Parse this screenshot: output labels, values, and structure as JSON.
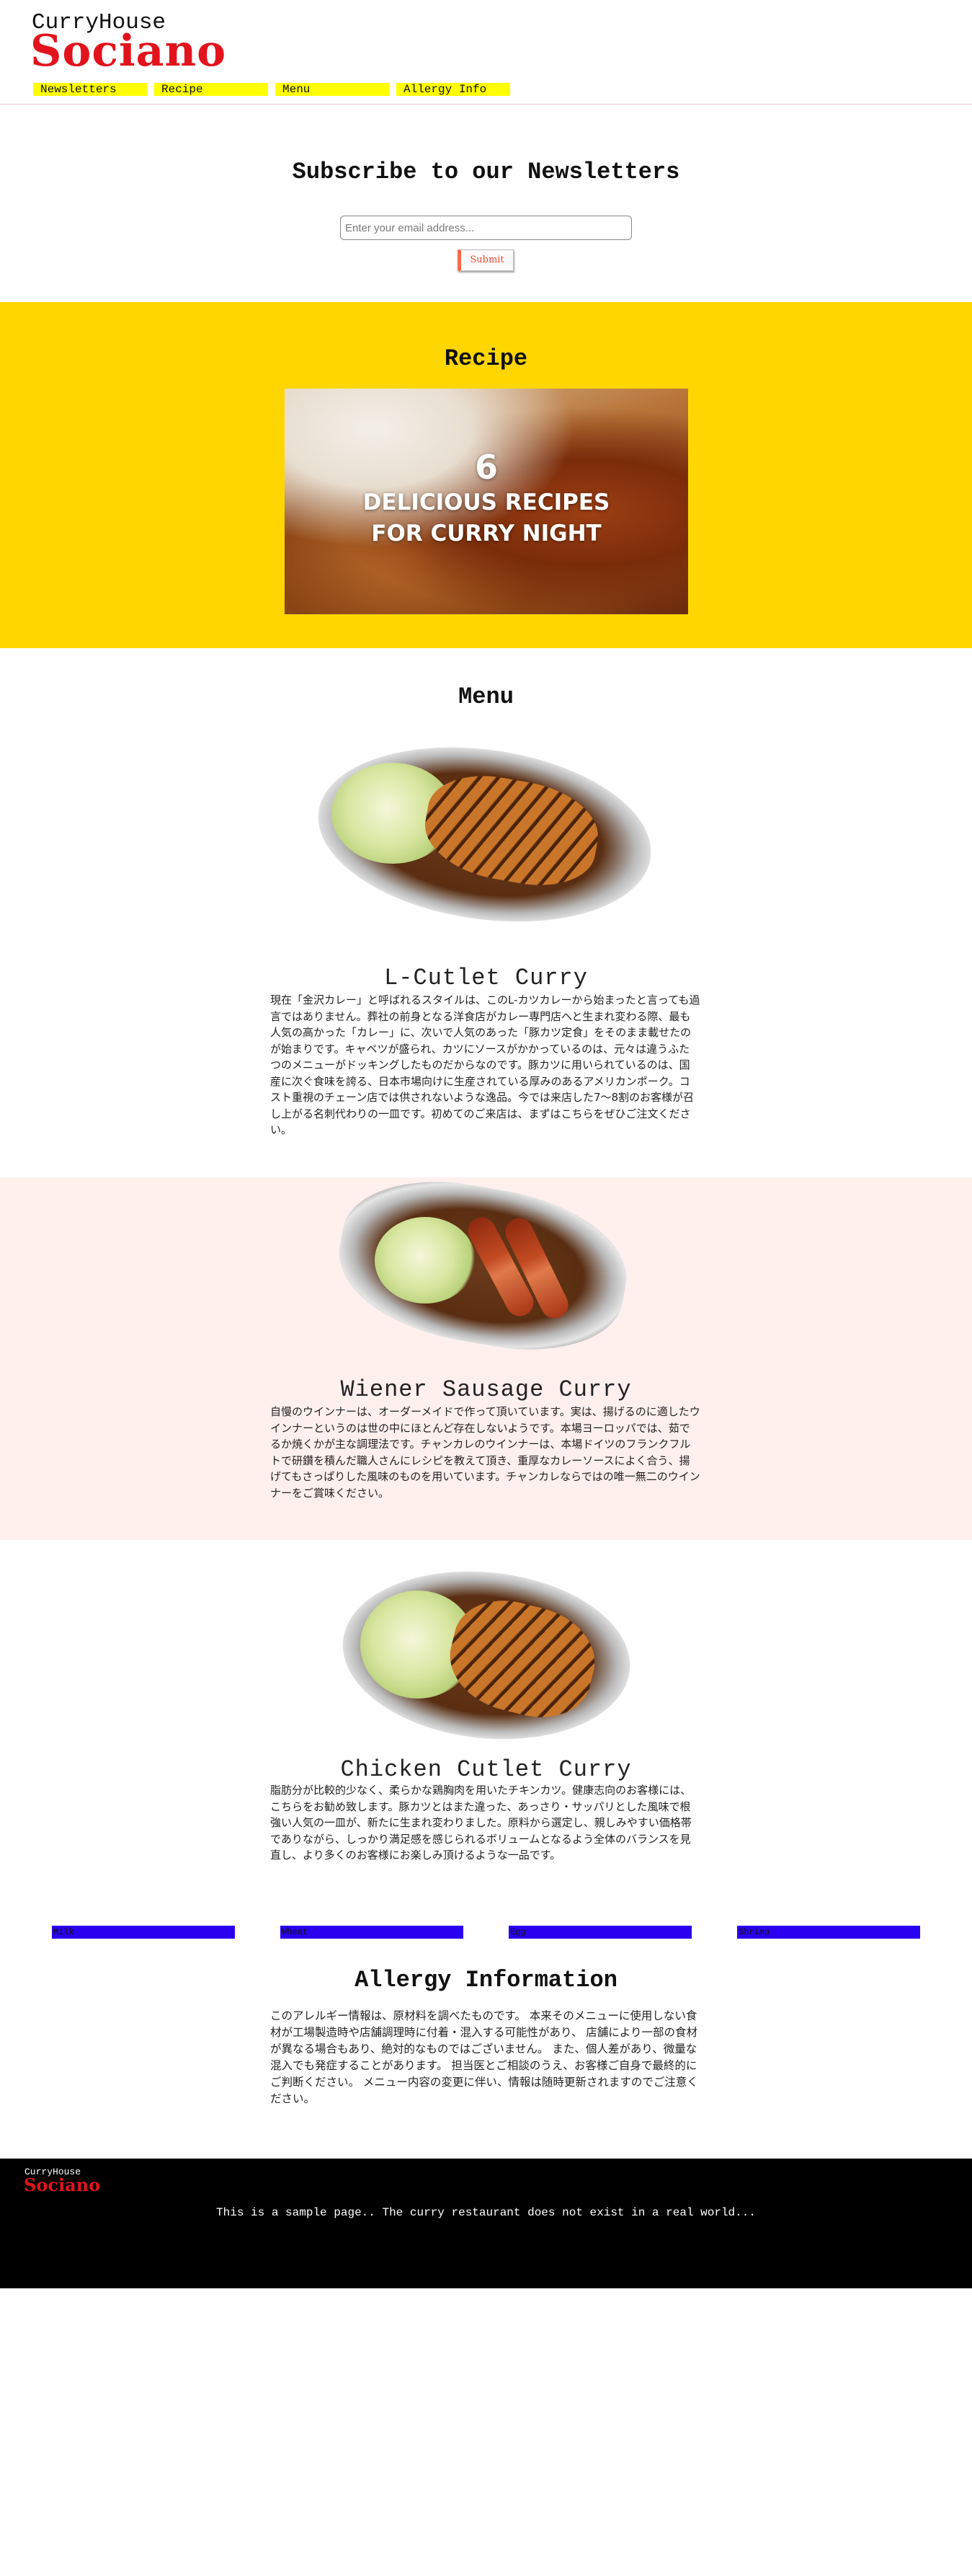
{
  "header": {
    "brand_small": "CurryHouse",
    "brand_big": "Sociano",
    "nav": [
      "Newsletters",
      "Recipe",
      "Menu",
      "Allergy Info"
    ]
  },
  "subscribe": {
    "title": "Subscribe to our Newsletters",
    "email_placeholder": "Enter your email address...",
    "submit_label": "Submit"
  },
  "recipe": {
    "title": "Recipe",
    "image_text": {
      "number": "6",
      "line1": "DELICIOUS RECIPES",
      "line2": "FOR CURRY NIGHT"
    }
  },
  "menu": {
    "title": "Menu",
    "items": [
      {
        "name": "L-Cutlet Curry",
        "description": "現在「金沢カレー」と呼ばれるスタイルは、このL-カツカレーから始まったと言っても過言ではありません。葬社の前身となる洋食店がカレー専門店へと生まれ変わる際、最も人気の高かった「カレー」に、次いで人気のあった「豚カツ定食」をそのまま載せたのが始まりです。キャベツが盛られ、カツにソースがかかっているのは、元々は違うふたつのメニューがドッキングしたものだからなのです。豚カツに用いられているのは、国産に次ぐ食味を誇る、日本市場向けに生産されている厚みのあるアメリカンポーク。コスト重視のチェーン店では供されないような逸品。今では来店した7〜8割のお客様が召し上がる名刺代わりの一皿です。初めてのご来店は、まずはこちらをぜひご注文ください。"
      },
      {
        "name": "Wiener Sausage Curry",
        "description": "自慢のウインナーは、オーダーメイドで作って頂いています。実は、揚げるのに適したウインナーというのは世の中にほとんど存在しないようです。本場ヨーロッパでは、茹でるか焼くかが主な調理法です。チャンカレのウインナーは、本場ドイツのフランクフルトで研鑽を積んだ職人さんにレシピを教えて頂き、重厚なカレーソースによく合う、揚げてもさっぱりした風味のものを用いています。チャンカレならではの唯一無二のウインナーをご賞味ください。"
      },
      {
        "name": "Chicken Cutlet Curry",
        "description": "脂肪分が比較的少なく、柔らかな鶏胸肉を用いたチキンカツ。健康志向のお客様には、こちらをお勧め致します。豚カツとはまた違った、あっさり・サッパリとした風味で根強い人気の一皿が、新たに生まれ変わりました。原料から選定し、親しみやすい価格帯でありながら、しっかり満足感を感じられるボリュームとなるよう全体のバランスを見直し、より多くのお客様にお楽しみ頂けるような一品です。"
      }
    ]
  },
  "allergy": {
    "tabs": [
      "Milk",
      "Wheat",
      "Egg",
      "Shrimp"
    ],
    "title": "Allergy Information",
    "text": "このアレルギー情報は、原材料を調べたものです。 本来そのメニューに使用しない食材が工場製造時や店舗調理時に付着・混入する可能性があり、 店舗により一部の食材が異なる場合もあり、絶対的なものではございません。 また、個人差があり、微量な混入でも発症することがあります。 担当医とご相談のうえ、お客様ご自身で最終的にご判断ください。 メニュー内容の変更に伴い、情報は随時更新されますのでご注意ください。"
  },
  "footer": {
    "brand_small": "CurryHouse",
    "brand_big": "Sociano",
    "note": "This is a sample page.. The curry restaurant does not exist in a real world..."
  },
  "colors": {
    "brand_red": "#e2131c",
    "nav_yellow": "#ffff00",
    "recipe_bg": "#ffd600",
    "sausage_bg": "#fff0ee",
    "allergy_tab": "#2a00f0",
    "footer_bg": "#000000"
  }
}
